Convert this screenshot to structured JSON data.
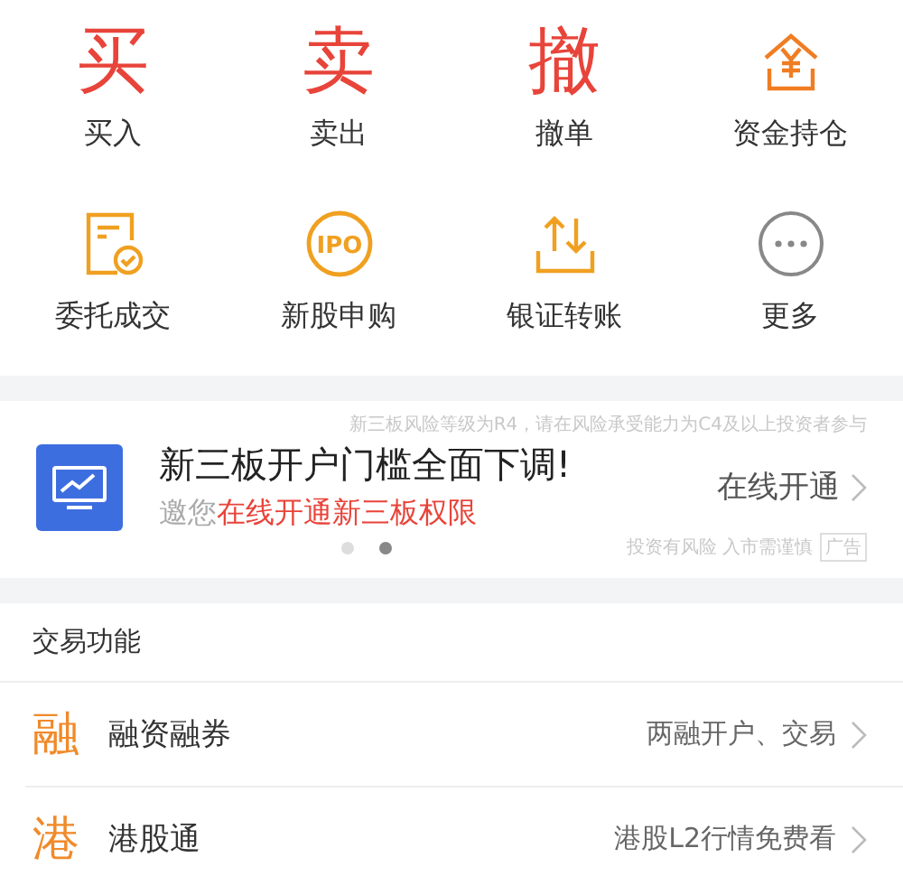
{
  "actions": [
    {
      "kind": "glyph",
      "glyph": "买",
      "label": "买入",
      "color": "#e8443a"
    },
    {
      "kind": "glyph",
      "glyph": "卖",
      "label": "卖出",
      "color": "#e8443a"
    },
    {
      "kind": "glyph",
      "glyph": "撤",
      "label": "撤单",
      "color": "#e8443a"
    },
    {
      "kind": "house-yen",
      "label": "资金持仓",
      "color": "#f07d22"
    },
    {
      "kind": "document-check",
      "label": "委托成交",
      "color": "#f0a020"
    },
    {
      "kind": "ipo",
      "label": "新股申购",
      "color": "#f0a020",
      "icon_text": "IPO"
    },
    {
      "kind": "transfer",
      "label": "银证转账",
      "color": "#f0a020"
    },
    {
      "kind": "more",
      "label": "更多",
      "color": "#888888"
    }
  ],
  "banner": {
    "notice": "新三板风险等级为R4，请在风险承受能力为C4及以上投资者参与",
    "title": "新三板开户门槛全面下调!",
    "subtitle_prefix": "邀您",
    "subtitle_highlight": "在线开通新三板权限",
    "action": "在线开通",
    "disclaimer": "投资有风险 入市需谨慎",
    "ad_tag": "广告",
    "dots": [
      {
        "selected": false
      },
      {
        "selected": true
      }
    ]
  },
  "section": {
    "title": "交易功能",
    "rows": [
      {
        "glyph": "融",
        "label": "融资融券",
        "detail": "两融开户、交易"
      },
      {
        "glyph": "港",
        "label": "港股通",
        "detail": "港股L2行情免费看"
      }
    ]
  }
}
